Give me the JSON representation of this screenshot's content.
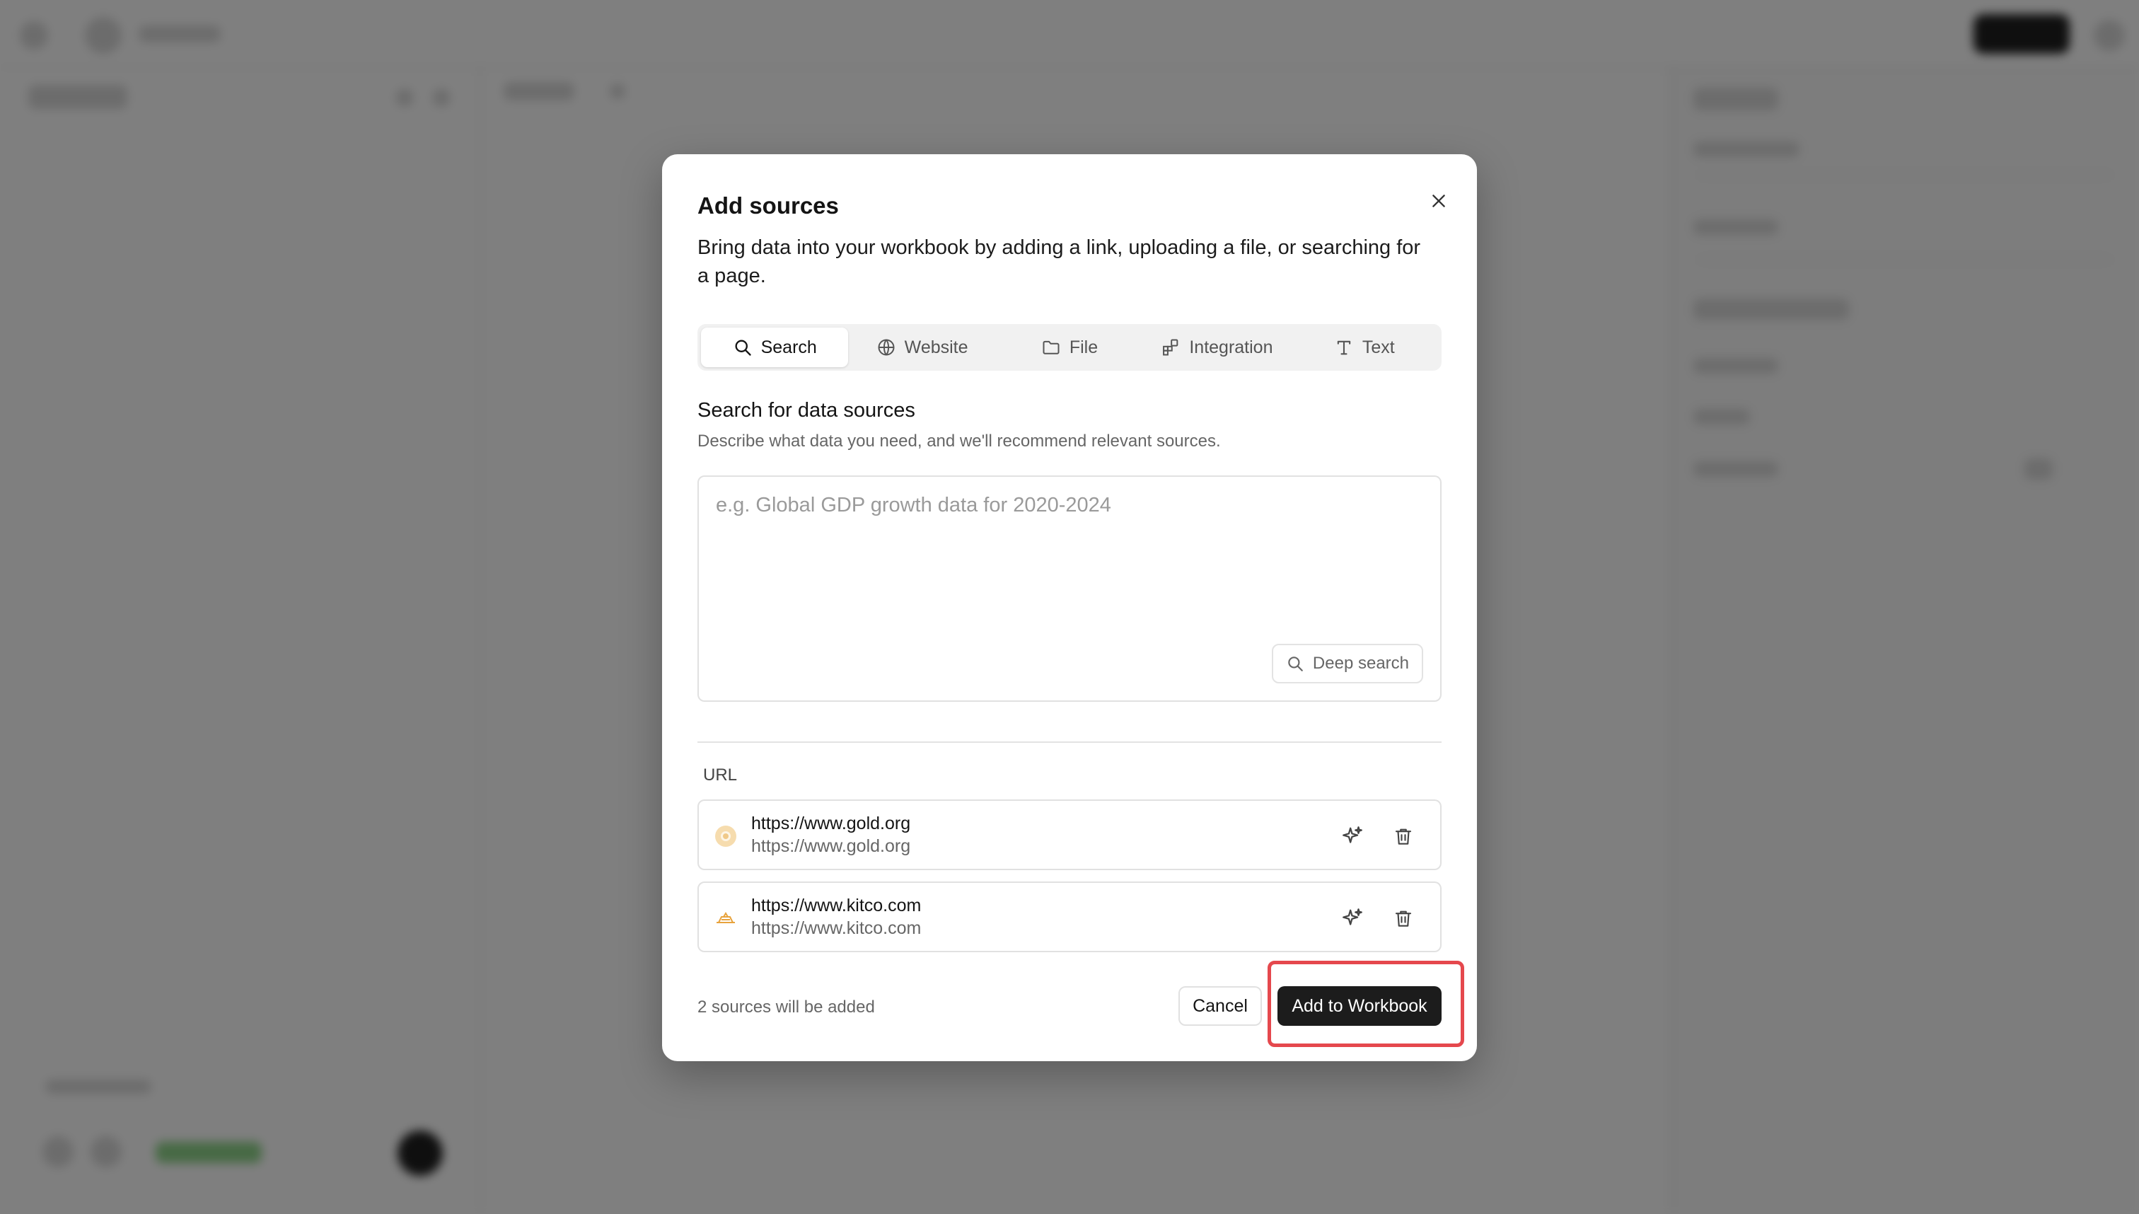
{
  "modal": {
    "title": "Add sources",
    "description": "Bring data into your workbook by adding a link, uploading a file, or searching for a page.",
    "close_icon": "close-icon",
    "tabs": [
      {
        "label": "Search",
        "icon": "search-icon",
        "active": true
      },
      {
        "label": "Website",
        "icon": "globe-icon",
        "active": false
      },
      {
        "label": "File",
        "icon": "folder-icon",
        "active": false
      },
      {
        "label": "Integration",
        "icon": "integration-icon",
        "active": false
      },
      {
        "label": "Text",
        "icon": "text-icon",
        "active": false
      }
    ],
    "search": {
      "title": "Search for data sources",
      "subtitle": "Describe what data you need, and we'll recommend relevant sources.",
      "placeholder": "e.g. Global GDP growth data for 2020-2024",
      "value": "",
      "deep_search_label": "Deep search"
    },
    "url_section": {
      "label": "URL",
      "items": [
        {
          "title": "https://www.gold.org",
          "subtitle": "https://www.gold.org",
          "favicon": "gold-favicon"
        },
        {
          "title": "https://www.kitco.com",
          "subtitle": "https://www.kitco.com",
          "favicon": "kitco-favicon"
        }
      ]
    },
    "footer": {
      "note": "2 sources will be added",
      "cancel_label": "Cancel",
      "add_label": "Add to Workbook"
    }
  },
  "colors": {
    "overlay": "rgba(0,0,0,0.50)",
    "primary_button": "#1c1c1c",
    "highlight": "#e5484d",
    "gold_favicon": "#f0c989",
    "kitco_favicon": "#e8a33d"
  }
}
